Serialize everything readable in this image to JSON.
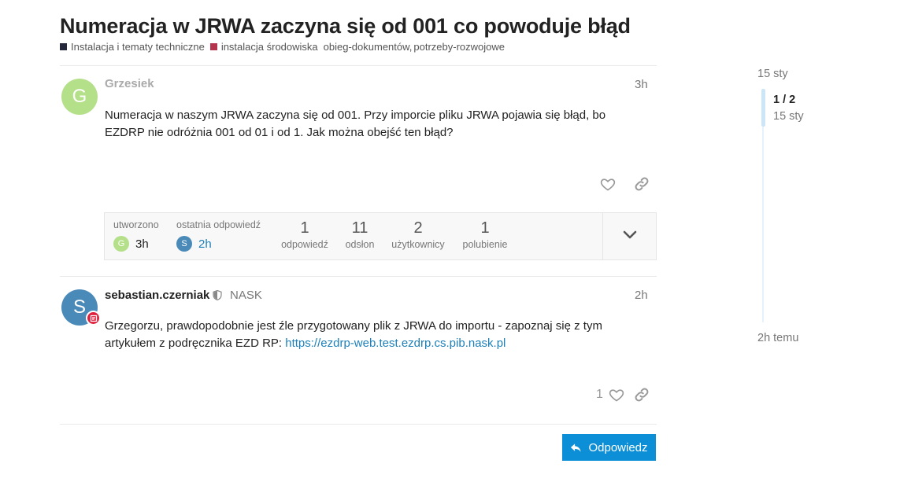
{
  "topic": {
    "title": "Numeracja w JRWA zaczyna się od 001 co powoduje błąd",
    "categories": [
      {
        "label": "Instalacja i tematy techniczne",
        "color": "#25283a"
      },
      {
        "label": "instalacja środowiska",
        "color": "#b3344c"
      }
    ],
    "tags": [
      "obieg-dokumentów,",
      "potrzeby-rozwojowe"
    ]
  },
  "posts": [
    {
      "avatar_letter": "G",
      "avatar_color": "#b5e08a",
      "username": "Grzesiek",
      "date": "3h",
      "body": "Numeracja w naszym JRWA zaczyna się od 001. Przy imporcie pliku JRWA pojawia się błąd, bo EZDRP nie odróżnia 001 od 01 i od 1. Jak można obejść ten błąd?"
    },
    {
      "avatar_letter": "S",
      "avatar_color": "#4a8ab8",
      "username": "sebastian.czerniak",
      "group": "NASK",
      "date": "2h",
      "body_text": "Grzegorzu, prawdopodobnie jest źle przygotowany plik z JRWA do importu - zapoznaj się z tym artykułem z podręcznika EZD RP: ",
      "link": "https://ezdrp-web.test.ezdrp.cs.pib.nask.pl",
      "like_count": "1"
    }
  ],
  "topic_map": {
    "created_label": "utworzono",
    "created_avatar_letter": "G",
    "created_value": "3h",
    "last_reply_label": "ostatnia odpowiedź",
    "last_reply_avatar_letter": "S",
    "last_reply_value": "2h",
    "stats": [
      {
        "num": "1",
        "label": "odpowiedź"
      },
      {
        "num": "11",
        "label": "odsłon"
      },
      {
        "num": "2",
        "label": "użytkownicy"
      },
      {
        "num": "1",
        "label": "polubienie"
      }
    ]
  },
  "reply_button": {
    "label": "Odpowiedz"
  },
  "timeline": {
    "start_date": "15 sty",
    "position": "1 / 2",
    "position_date": "15 sty",
    "end_label": "2h temu"
  },
  "icons": {
    "like": "heart-icon",
    "share": "link-icon",
    "expand": "chevron-down-icon",
    "reply": "reply-arrow-icon",
    "moderator": "shield-icon",
    "badge": "badge-icon"
  }
}
